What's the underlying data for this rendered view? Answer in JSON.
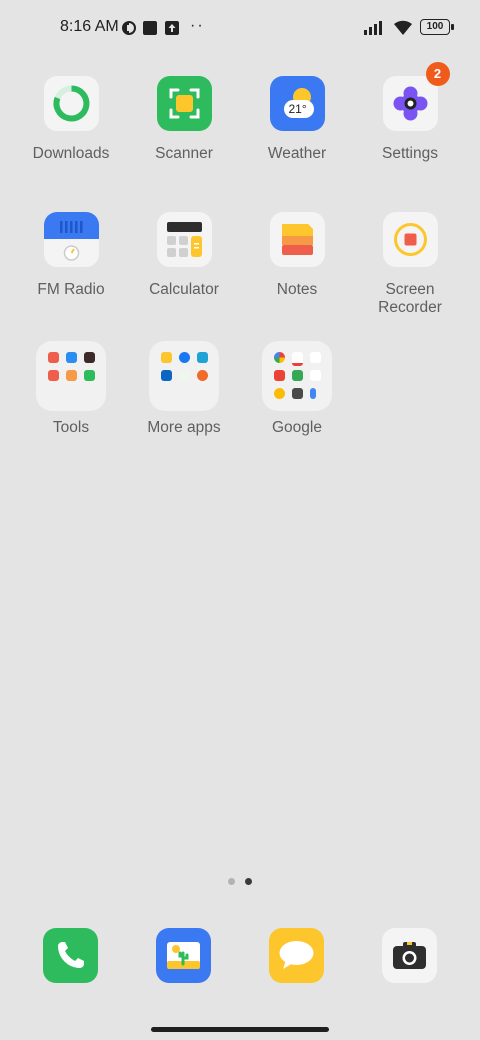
{
  "status": {
    "time": "8:16 AM",
    "battery": "100"
  },
  "apps": [
    {
      "label": "Downloads"
    },
    {
      "label": "Scanner"
    },
    {
      "label": "Weather",
      "temp": "21°"
    },
    {
      "label": "Settings",
      "badge": "2"
    },
    {
      "label": "FM Radio"
    },
    {
      "label": "Calculator"
    },
    {
      "label": "Notes"
    },
    {
      "label": "Screen Recorder"
    }
  ],
  "folders": [
    {
      "label": "Tools"
    },
    {
      "label": "More apps"
    },
    {
      "label": "Google"
    }
  ],
  "pager": {
    "pages": 2,
    "current": 2
  },
  "dock": [
    {
      "icon": "phone-icon"
    },
    {
      "icon": "gallery-icon"
    },
    {
      "icon": "messages-icon"
    },
    {
      "icon": "camera-icon"
    }
  ],
  "colors": {
    "background": "#e4e4e4",
    "badge": "#f05a1a",
    "green": "#2dbb5d",
    "blue": "#3a79f2",
    "yellow": "#fcc62c",
    "purple": "#7a54f2"
  }
}
